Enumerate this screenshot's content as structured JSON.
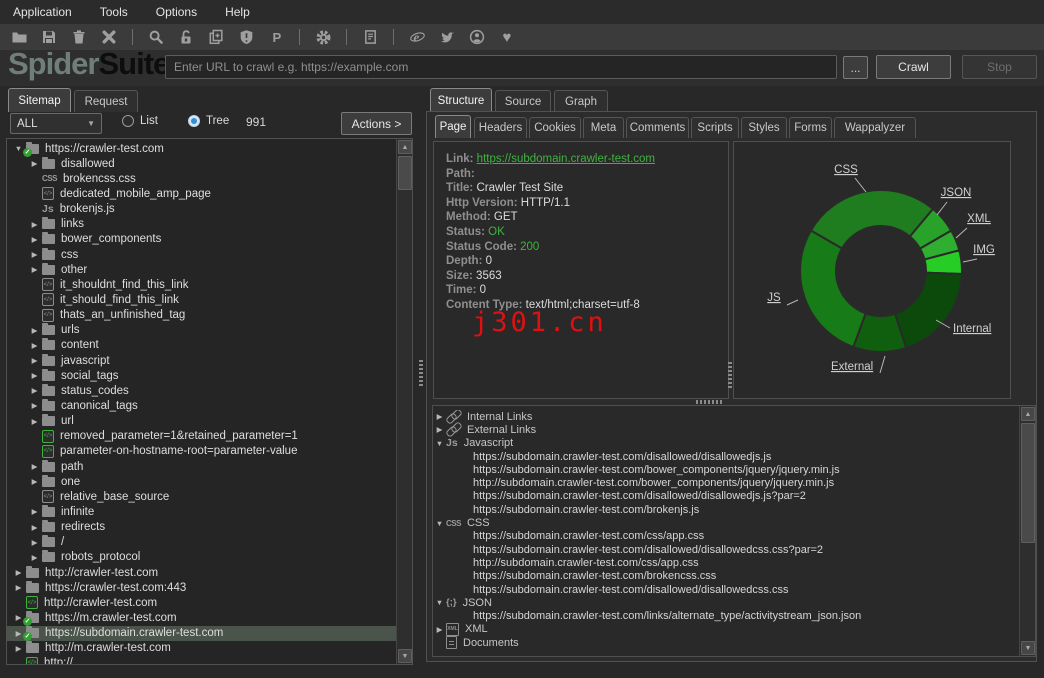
{
  "app_title": "SpiderSuite",
  "menubar": {
    "items": [
      "Application",
      "Tools",
      "Options",
      "Help"
    ]
  },
  "toolbar": {
    "icons": [
      "open-folder",
      "save",
      "trash",
      "close-x",
      "search",
      "unlock",
      "copy-page",
      "shield-alert",
      "proxy-p",
      "settings-gear",
      "report-document",
      "browser-e",
      "twitter-bird",
      "about-person",
      "donate-heart"
    ]
  },
  "header": {
    "logo_primary": "Spider",
    "logo_secondary": "Suite",
    "url_placeholder": "Enter URL to crawl e.g. https://example.com",
    "url_value": "",
    "browse_label": "...",
    "crawl_label": "Crawl",
    "stop_label": "Stop"
  },
  "left_panel": {
    "tabs": [
      "Sitemap",
      "Request"
    ],
    "active_tab": "Sitemap",
    "filter_value": "ALL",
    "view_options": [
      "List",
      "Tree"
    ],
    "selected_view": "Tree",
    "count": "991",
    "actions_label": "Actions >",
    "tree": [
      {
        "arrow": "expanded",
        "icon": "folder-check",
        "indent": 0,
        "label": "https://crawler-test.com"
      },
      {
        "arrow": "collapsed",
        "icon": "folder",
        "indent": 1,
        "label": "disallowed"
      },
      {
        "arrow": null,
        "icon": "css",
        "indent": 1,
        "label": "brokencss.css"
      },
      {
        "arrow": null,
        "icon": "code",
        "indent": 1,
        "label": "dedicated_mobile_amp_page"
      },
      {
        "arrow": null,
        "icon": "js",
        "indent": 1,
        "label": "brokenjs.js"
      },
      {
        "arrow": "collapsed",
        "icon": "folder",
        "indent": 1,
        "label": "links"
      },
      {
        "arrow": "collapsed",
        "icon": "folder",
        "indent": 1,
        "label": "bower_components"
      },
      {
        "arrow": "collapsed",
        "icon": "folder",
        "indent": 1,
        "label": "css"
      },
      {
        "arrow": "collapsed",
        "icon": "folder",
        "indent": 1,
        "label": "other"
      },
      {
        "arrow": null,
        "icon": "code",
        "indent": 1,
        "label": "it_shouldnt_find_this_link"
      },
      {
        "arrow": null,
        "icon": "code",
        "indent": 1,
        "label": "it_should_find_this_link"
      },
      {
        "arrow": null,
        "icon": "code",
        "indent": 1,
        "label": "thats_an_unfinished_tag"
      },
      {
        "arrow": "collapsed",
        "icon": "folder",
        "indent": 1,
        "label": "urls"
      },
      {
        "arrow": "collapsed",
        "icon": "folder",
        "indent": 1,
        "label": "content"
      },
      {
        "arrow": "collapsed",
        "icon": "folder",
        "indent": 1,
        "label": "javascript"
      },
      {
        "arrow": "collapsed",
        "icon": "folder",
        "indent": 1,
        "label": "social_tags"
      },
      {
        "arrow": "collapsed",
        "icon": "folder",
        "indent": 1,
        "label": "status_codes"
      },
      {
        "arrow": "collapsed",
        "icon": "folder",
        "indent": 1,
        "label": "canonical_tags"
      },
      {
        "arrow": "collapsed",
        "icon": "folder",
        "indent": 1,
        "label": "url"
      },
      {
        "arrow": null,
        "icon": "code-green",
        "indent": 1,
        "label": "removed_parameter=1&retained_parameter=1"
      },
      {
        "arrow": null,
        "icon": "code-green",
        "indent": 1,
        "label": "parameter-on-hostname-root=parameter-value"
      },
      {
        "arrow": "collapsed",
        "icon": "folder",
        "indent": 1,
        "label": "path"
      },
      {
        "arrow": "collapsed",
        "icon": "folder",
        "indent": 1,
        "label": "one"
      },
      {
        "arrow": null,
        "icon": "code",
        "indent": 1,
        "label": "relative_base_source"
      },
      {
        "arrow": "collapsed",
        "icon": "folder",
        "indent": 1,
        "label": "infinite"
      },
      {
        "arrow": "collapsed",
        "icon": "folder",
        "indent": 1,
        "label": "redirects"
      },
      {
        "arrow": "collapsed",
        "icon": "folder",
        "indent": 1,
        "label": "/"
      },
      {
        "arrow": "collapsed",
        "icon": "folder",
        "indent": 1,
        "label": "robots_protocol"
      },
      {
        "arrow": "collapsed",
        "icon": "folder",
        "indent": 0,
        "label": "http://crawler-test.com"
      },
      {
        "arrow": "collapsed",
        "icon": "folder",
        "indent": 0,
        "label": "https://crawler-test.com:443"
      },
      {
        "arrow": null,
        "icon": "code-green",
        "indent": 0,
        "label": "http://crawler-test.com"
      },
      {
        "arrow": "collapsed",
        "icon": "folder-check",
        "indent": 0,
        "label": "https://m.crawler-test.com"
      },
      {
        "arrow": "collapsed",
        "icon": "folder-check",
        "indent": 0,
        "label": "https://subdomain.crawler-test.com",
        "selected": true
      },
      {
        "arrow": "collapsed",
        "icon": "folder",
        "indent": 0,
        "label": "http://m.crawler-test.com"
      },
      {
        "arrow": null,
        "icon": "code-green",
        "indent": 0,
        "label": "http://…",
        "partial": true
      }
    ]
  },
  "right_panel": {
    "tabs": [
      "Structure",
      "Source",
      "Graph"
    ],
    "active_tab": "Structure",
    "subtabs": [
      "Page",
      "Headers",
      "Cookies",
      "Meta",
      "Comments",
      "Scripts",
      "Styles",
      "Forms",
      "Wappalyzer"
    ],
    "active_subtab": "Page",
    "page_info": {
      "fields": [
        {
          "label": "Link:",
          "value": "https://subdomain.crawler-test.com",
          "style": "link"
        },
        {
          "label": "Path:",
          "value": "",
          "style": "plain"
        },
        {
          "label": "Title:",
          "value": "Crawler Test Site",
          "style": "plain"
        },
        {
          "label": "Http Version:",
          "value": "HTTP/1.1",
          "style": "plain"
        },
        {
          "label": "Method:",
          "value": "GET",
          "style": "plain"
        },
        {
          "label": "Status:",
          "value": "OK",
          "style": "green"
        },
        {
          "label": "Status Code:",
          "value": "200",
          "style": "green"
        },
        {
          "label": "Depth:",
          "value": "0",
          "style": "plain"
        },
        {
          "label": "Size:",
          "value": "3563",
          "style": "plain"
        },
        {
          "label": "Time:",
          "value": "0",
          "style": "plain"
        },
        {
          "label": "Content Type:",
          "value": "text/html;charset=utf-8",
          "style": "plain"
        }
      ],
      "watermark": "j301.cn"
    },
    "links_tree": [
      {
        "type": "group",
        "arrow": "collapsed",
        "icon": "link",
        "label": "Internal Links"
      },
      {
        "type": "group",
        "arrow": "collapsed",
        "icon": "link",
        "label": "External Links"
      },
      {
        "type": "group",
        "arrow": "expanded",
        "icon": "js",
        "label": "Javascript"
      },
      {
        "type": "url",
        "label": "https://subdomain.crawler-test.com/disallowed/disallowedjs.js"
      },
      {
        "type": "url",
        "label": "https://subdomain.crawler-test.com/bower_components/jquery/jquery.min.js"
      },
      {
        "type": "url",
        "label": "http://subdomain.crawler-test.com/bower_components/jquery/jquery.min.js"
      },
      {
        "type": "url",
        "label": "https://subdomain.crawler-test.com/disallowed/disallowedjs.js?par=2"
      },
      {
        "type": "url",
        "label": "https://subdomain.crawler-test.com/brokenjs.js"
      },
      {
        "type": "group",
        "arrow": "expanded",
        "icon": "css",
        "label": "CSS"
      },
      {
        "type": "url",
        "label": "https://subdomain.crawler-test.com/css/app.css"
      },
      {
        "type": "url",
        "label": "https://subdomain.crawler-test.com/disallowed/disallowedcss.css?par=2"
      },
      {
        "type": "url",
        "label": "http://subdomain.crawler-test.com/css/app.css"
      },
      {
        "type": "url",
        "label": "https://subdomain.crawler-test.com/brokencss.css"
      },
      {
        "type": "url",
        "label": "https://subdomain.crawler-test.com/disallowed/disallowedcss.css"
      },
      {
        "type": "group",
        "arrow": "expanded",
        "icon": "json",
        "label": "JSON"
      },
      {
        "type": "url",
        "label": "https://subdomain.crawler-test.com/links/alternate_type/activitystream_json.json"
      },
      {
        "type": "group",
        "arrow": "collapsed",
        "icon": "xml",
        "label": "XML"
      },
      {
        "type": "group",
        "arrow": null,
        "icon": "doc",
        "label": "Documents"
      }
    ]
  },
  "chart_data": {
    "type": "pie",
    "subtype": "donut",
    "title": "",
    "legend_position": "callout-labels",
    "start_angle_deg": 300,
    "values_are": "percent, estimated from arc angles",
    "series": [
      {
        "name": "CSS",
        "value": 27.8,
        "color": "#1f7d1f"
      },
      {
        "name": "JSON",
        "value": 5.6,
        "color": "#28a228"
      },
      {
        "name": "XML",
        "value": 4.2,
        "color": "#2fae2f"
      },
      {
        "name": "IMG",
        "value": 4.7,
        "color": "#25cd25"
      },
      {
        "name": "Internal",
        "value": 19.4,
        "color": "#0b4a0b"
      },
      {
        "name": "External",
        "value": 10.6,
        "color": "#0f5f0f"
      },
      {
        "name": "JS",
        "value": 27.8,
        "color": "#177c17"
      }
    ]
  },
  "colors": {
    "accent_green": "#3db53d",
    "selected_row": "#4a544b",
    "radio_selected_blue": "#2f8fd8",
    "watermark_red": "#e01010"
  }
}
